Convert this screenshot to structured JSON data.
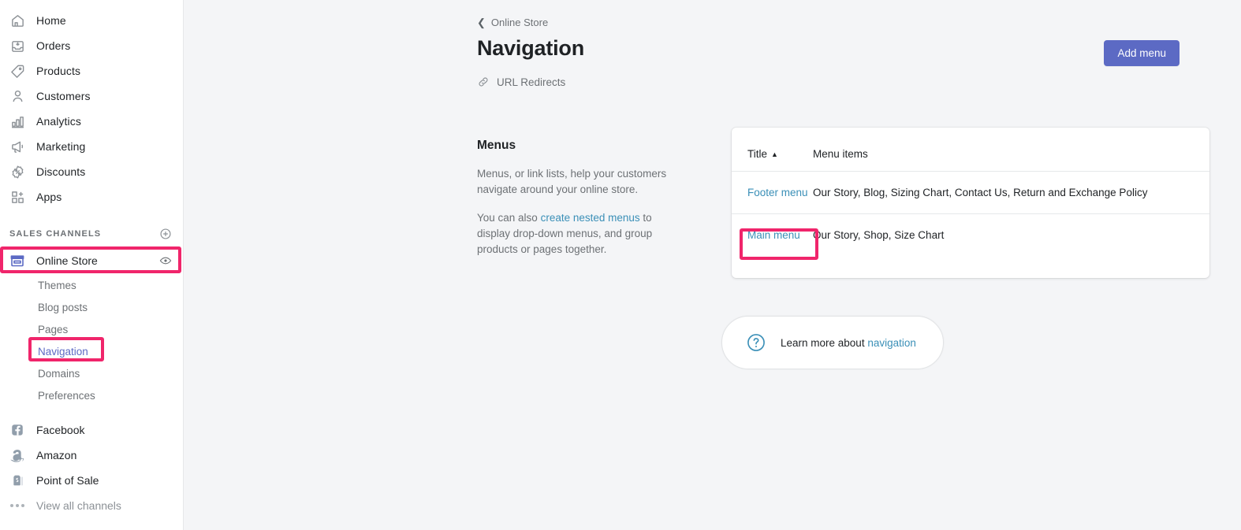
{
  "sidebar": {
    "primary_items": [
      {
        "label": "Home",
        "icon": "home-icon"
      },
      {
        "label": "Orders",
        "icon": "orders-icon"
      },
      {
        "label": "Products",
        "icon": "products-tag-icon"
      },
      {
        "label": "Customers",
        "icon": "customers-person-icon"
      },
      {
        "label": "Analytics",
        "icon": "analytics-bar-chart-icon"
      },
      {
        "label": "Marketing",
        "icon": "marketing-megaphone-icon"
      },
      {
        "label": "Discounts",
        "icon": "discounts-percent-icon"
      },
      {
        "label": "Apps",
        "icon": "apps-grid-icon"
      }
    ],
    "sales_channels": {
      "heading": "SALES CHANNELS",
      "add_icon": "plus-circle-icon",
      "online_store": {
        "label": "Online Store",
        "icon": "online-store-icon",
        "view_icon": "eye-icon",
        "highlighted": true
      },
      "sub_items": [
        {
          "label": "Themes",
          "active": false
        },
        {
          "label": "Blog posts",
          "active": false
        },
        {
          "label": "Pages",
          "active": false
        },
        {
          "label": "Navigation",
          "active": true,
          "highlighted": true
        },
        {
          "label": "Domains",
          "active": false
        },
        {
          "label": "Preferences",
          "active": false
        }
      ],
      "other_channels": [
        {
          "label": "Facebook",
          "icon": "facebook-icon",
          "muted": false
        },
        {
          "label": "Amazon",
          "icon": "amazon-icon",
          "muted": false
        },
        {
          "label": "Point of Sale",
          "icon": "point-of-sale-icon",
          "muted": false
        },
        {
          "label": "View all channels",
          "icon": "ellipsis-icon",
          "muted": true
        }
      ]
    }
  },
  "header": {
    "breadcrumb": "Online Store",
    "breadcrumb_icon": "chevron-left-icon",
    "title": "Navigation",
    "url_redirects_label": "URL Redirects",
    "url_redirects_icon": "link-chain-icon",
    "add_menu_label": "Add menu"
  },
  "intro": {
    "heading": "Menus",
    "paragraph_1": "Menus, or link lists, help your customers navigate around your online store.",
    "p2_before": "You can also ",
    "p2_link": "create nested menus",
    "p2_after": " to display drop-down menus, and group products or pages together."
  },
  "table": {
    "columns": [
      {
        "label": "Title",
        "sort_indicator": "▲"
      },
      {
        "label": "Menu items"
      }
    ],
    "rows": [
      {
        "title": "Footer menu",
        "items": "Our Story, Blog, Sizing Chart, Contact Us, Return and Exchange Policy",
        "highlighted": false
      },
      {
        "title": "Main menu",
        "items": "Our Story, Shop, Size Chart",
        "highlighted": true
      }
    ]
  },
  "help": {
    "icon": "question-circle-icon",
    "text_before": "Learn more about ",
    "link": "navigation"
  },
  "colors": {
    "highlight_box": "#f0256b",
    "primary_button": "#5c6ac4",
    "link": "#3a8fb7",
    "active_nav": "#5c6ac4",
    "page_background": "#f4f5f7",
    "card_background": "#ffffff"
  }
}
